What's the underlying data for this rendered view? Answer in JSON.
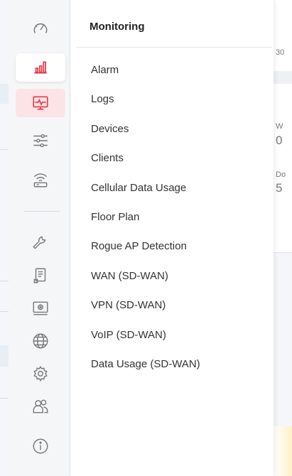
{
  "flyout": {
    "title": "Monitoring",
    "items": [
      {
        "label": "Alarm"
      },
      {
        "label": "Logs"
      },
      {
        "label": "Devices"
      },
      {
        "label": "Clients"
      },
      {
        "label": "Cellular Data Usage"
      },
      {
        "label": "Floor Plan"
      },
      {
        "label": "Rogue AP Detection"
      },
      {
        "label": "WAN (SD-WAN)"
      },
      {
        "label": "VPN (SD-WAN)"
      },
      {
        "label": "VoIP (SD-WAN)"
      },
      {
        "label": "Data Usage (SD-WAN)"
      }
    ]
  },
  "rail": {
    "icons": [
      {
        "name": "dashboard-gauge-icon"
      },
      {
        "name": "bar-chart-icon",
        "selected": true
      },
      {
        "name": "monitor-pulse-icon",
        "active": true
      },
      {
        "name": "sliders-icon"
      },
      {
        "name": "wireless-router-icon"
      },
      {
        "name": "wrench-icon"
      },
      {
        "name": "document-icon"
      },
      {
        "name": "settings-panel-icon"
      },
      {
        "name": "globe-icon"
      },
      {
        "name": "gear-icon"
      },
      {
        "name": "users-icon"
      },
      {
        "name": "info-icon"
      }
    ],
    "accent_color": "#e63946",
    "active_bg": "#fbe3e6"
  },
  "background": {
    "fragments": [
      "30",
      "W",
      "0",
      "Do",
      "5"
    ]
  }
}
